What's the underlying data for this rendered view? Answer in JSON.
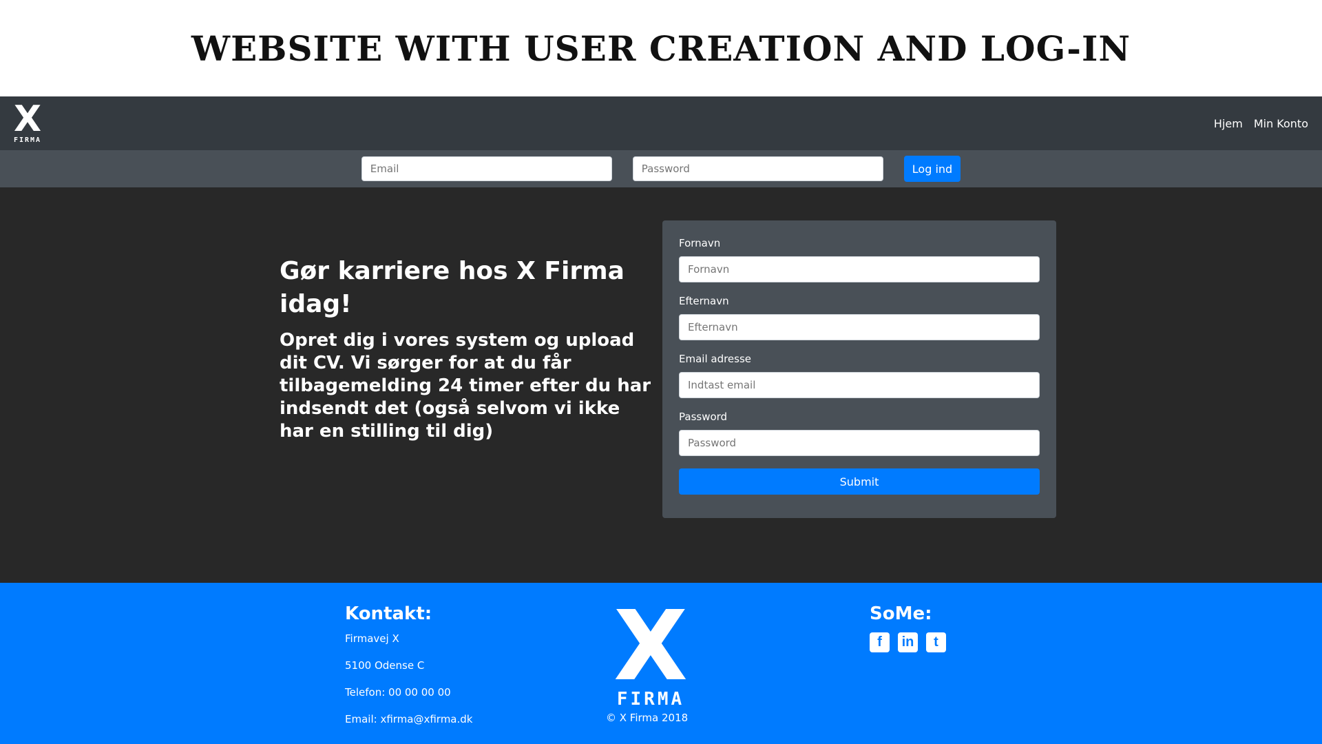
{
  "banner": {
    "title": "WEBSITE WITH USER CREATION AND LOG-IN"
  },
  "nav": {
    "brand_letter": "X",
    "brand_word": "FIRMA",
    "links": [
      "Hjem",
      "Min Konto"
    ]
  },
  "loginbar": {
    "email_placeholder": "Email",
    "password_placeholder": "Password",
    "login_label": "Log ind"
  },
  "hero": {
    "title": "Gør karriere hos X Firma idag!",
    "text": "Opret dig i vores system og upload dit CV. Vi sørger for at du får tilbagemelding 24 timer efter du har indsendt det (også selvom vi ikke har en stilling til dig)"
  },
  "form": {
    "fields": [
      {
        "label": "Fornavn",
        "placeholder": "Fornavn"
      },
      {
        "label": "Efternavn",
        "placeholder": "Efternavn"
      },
      {
        "label": "Email adresse",
        "placeholder": "Indtast email"
      },
      {
        "label": "Password",
        "placeholder": "Password"
      }
    ],
    "submit_label": "Submit"
  },
  "footer": {
    "contact_title": "Kontakt:",
    "contact_lines": [
      "Firmavej X",
      "5100 Odense C",
      "Telefon: 00 00 00 00",
      "Email: xfirma@xfirma.dk"
    ],
    "logo_letter": "X",
    "logo_word": "FIRMA",
    "copyright": "© X Firma 2018",
    "some_title": "SoMe:",
    "social": [
      {
        "icon": "facebook-icon",
        "glyph": "f"
      },
      {
        "icon": "linkedin-icon",
        "glyph": "in"
      },
      {
        "icon": "twitter-icon",
        "glyph": "t"
      }
    ]
  },
  "colors": {
    "navbar": "#343a40",
    "loginbar": "#495057",
    "main_bg": "#282828",
    "accent": "#007bff"
  }
}
